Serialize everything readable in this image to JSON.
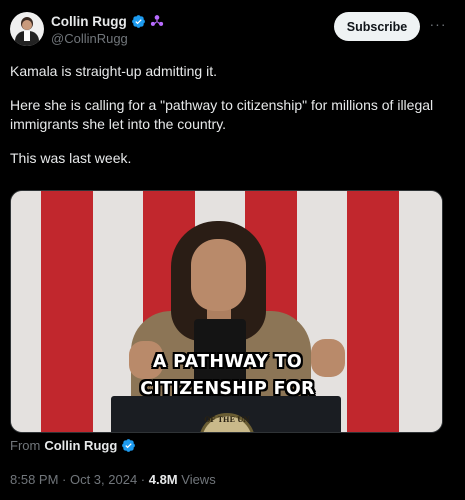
{
  "author": {
    "display_name": "Collin Rugg",
    "handle": "@CollinRugg",
    "verified_icon": "verified-badge-icon",
    "affiliation_icon": "affiliation-badge-icon"
  },
  "actions": {
    "subscribe_label": "Subscribe",
    "more_label": "···"
  },
  "tweet": {
    "paragraphs": [
      "Kamala is straight-up admitting it.",
      "Here she is calling for a \"pathway to citizenship\" for millions of illegal immigrants she let into the country.",
      "This was last week."
    ]
  },
  "media": {
    "caption_line1": "A PATHWAY TO",
    "caption_line2": "CITIZENSHIP FOR",
    "seal_text": "OF THE UN"
  },
  "attribution": {
    "prefix": "From",
    "name": "Collin Rugg"
  },
  "meta": {
    "time": "8:58 PM · Oct 3, 2024 · ",
    "views_count": "4.8M",
    "views_label": " Views"
  },
  "colors": {
    "background": "#000000",
    "verified_blue": "#1d9bf0",
    "affiliation_purple": "#b86bff",
    "stripe_red": "#c1272d",
    "stripe_white": "#e4e1df"
  }
}
